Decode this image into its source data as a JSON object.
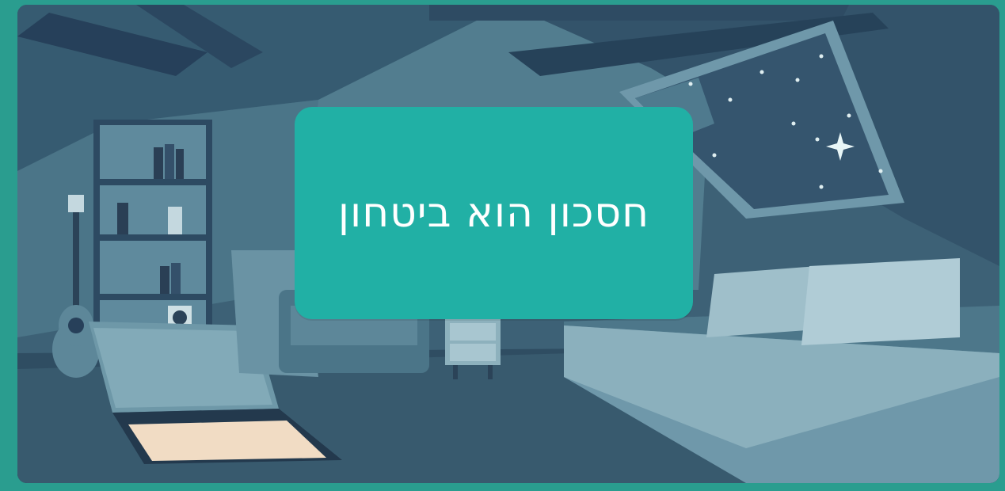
{
  "card": {
    "title": "חסכון הוא ביטחון"
  },
  "colors": {
    "frame": "#2a9d8f",
    "card_background": "#21b0a5",
    "card_text": "#ffffff",
    "scene_dark": "#2f4a63",
    "scene_mid": "#4a7186",
    "scene_light": "#8fb2be"
  }
}
